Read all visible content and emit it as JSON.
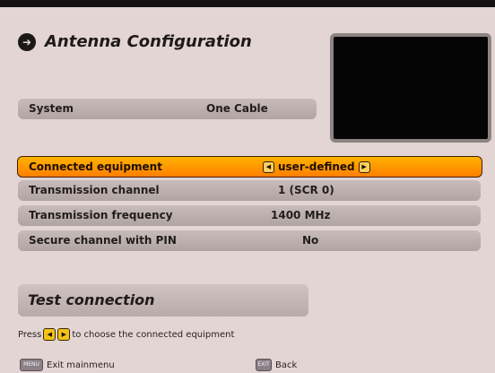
{
  "header": {
    "title": "Antenna Configuration",
    "icon": "arrow-right-circle-icon"
  },
  "system": {
    "label": "System",
    "value": "One Cable"
  },
  "settings": [
    {
      "label": "Connected equipment",
      "value": "user-defined",
      "selected": true
    },
    {
      "label": "Transmission channel",
      "value": "1  (SCR 0)"
    },
    {
      "label": "Transmission frequency",
      "value": "1400 MHz"
    },
    {
      "label": "Secure channel with PIN",
      "value": "No"
    }
  ],
  "test": {
    "label": "Test connection"
  },
  "hint": {
    "prefix": "Press",
    "suffix": "to choose the connected equipment"
  },
  "footer": {
    "left": {
      "key": "MENU",
      "label": "Exit mainmenu"
    },
    "right": {
      "key": "EXIT",
      "label": "Back"
    }
  },
  "colors": {
    "panel": "#e2d5d3",
    "selected_row": "#ff9a00",
    "row": "#bdb1af",
    "preview": "#050505"
  }
}
